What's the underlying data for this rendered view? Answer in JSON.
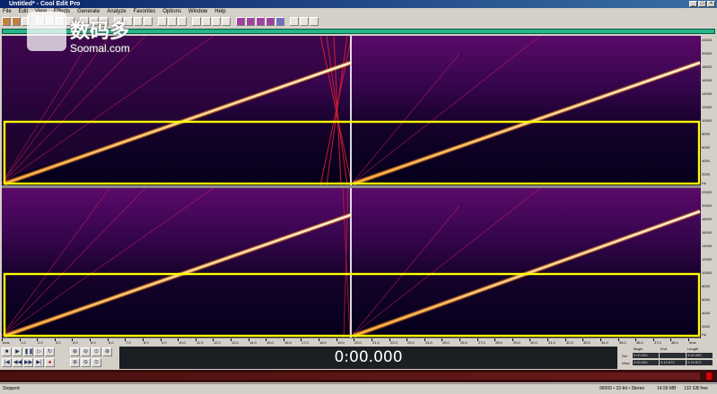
{
  "window": {
    "title": "Untitled* - Cool Edit Pro"
  },
  "menu": [
    "File",
    "Edit",
    "View",
    "Effects",
    "Generate",
    "Analyze",
    "Favorites",
    "Options",
    "Window",
    "Help"
  ],
  "spectral": {
    "freq_labels": [
      "22000",
      "20000",
      "18000",
      "16000",
      "14000",
      "12000",
      "10000",
      "8000",
      "6000",
      "4000",
      "2000",
      "Hz"
    ]
  },
  "time_labels": [
    "hms",
    "1.0",
    "2.0",
    "3.0",
    "4.0",
    "5.0",
    "6.0",
    "7.0",
    "8.0",
    "9.0",
    "10.0",
    "11.0",
    "12.0",
    "13.0",
    "14.0",
    "15.0",
    "16.0",
    "17.0",
    "18.0",
    "19.0",
    "20.0",
    "21.0",
    "22.0",
    "23.0",
    "24.0",
    "25.0",
    "26.0",
    "27.0",
    "28.0",
    "29.0",
    "30.0",
    "31.0",
    "32.0",
    "33.0",
    "34.0",
    "35.0",
    "36.0",
    "37.0",
    "38.0",
    "hms"
  ],
  "transport": {
    "row1": [
      "stop",
      "play",
      "pause",
      "play-loop",
      "loop"
    ],
    "row2": [
      "to-start",
      "rewind",
      "fast-forward",
      "to-end",
      "record"
    ],
    "zoom_row1": [
      "zoom-in-h",
      "zoom-out-h",
      "zoom-full"
    ],
    "zoom_row2": [
      "zoom-in-v",
      "zoom-out-v",
      "zoom-sel"
    ]
  },
  "time_display": "0:00.000",
  "selection": {
    "headers": [
      "Begin",
      "End",
      "Length"
    ],
    "sel_label": "Sel",
    "view_label": "View",
    "sel": [
      "0:00.000",
      "",
      "0:00.000"
    ],
    "view": [
      "0:00.000",
      "0:19.872",
      "0:19.872"
    ]
  },
  "status": {
    "left": "Stopped",
    "format": "96000 • 32-bit • Stereo",
    "size": "14.56 MB",
    "free": "132 GB free"
  },
  "watermark": {
    "cn": "数码多",
    "en": "Soomal.com"
  }
}
